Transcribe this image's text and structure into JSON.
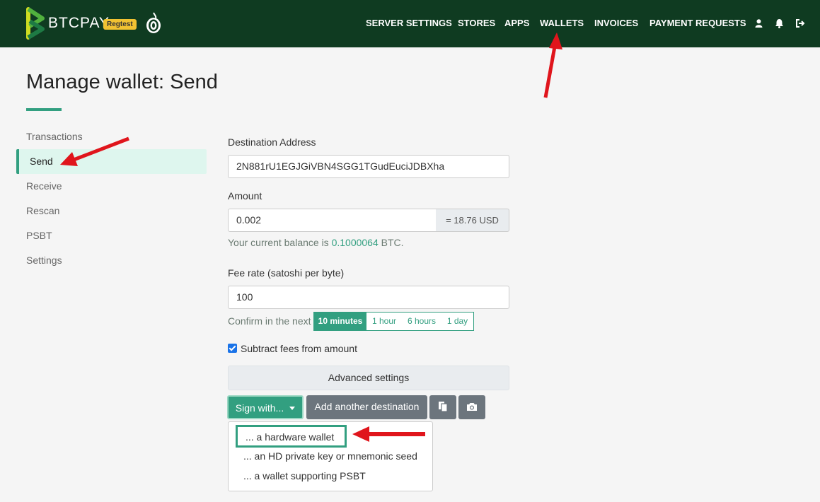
{
  "header": {
    "brand": "BTCPAY",
    "badge": "Regtest",
    "nav": [
      "SERVER SETTINGS",
      "STORES",
      "APPS",
      "WALLETS",
      "INVOICES",
      "PAYMENT REQUESTS"
    ]
  },
  "page": {
    "title": "Manage wallet: Send"
  },
  "sidebar": {
    "items": [
      {
        "label": "Transactions"
      },
      {
        "label": "Send",
        "active": true
      },
      {
        "label": "Receive"
      },
      {
        "label": "Rescan"
      },
      {
        "label": "PSBT"
      },
      {
        "label": "Settings"
      }
    ]
  },
  "form": {
    "destination_label": "Destination Address",
    "destination_value": "2N881rU1EGJGiVBN4SGG1TGudEuciJDBXha",
    "amount_label": "Amount",
    "amount_value": "0.002",
    "amount_fiat": "= 18.76 USD",
    "balance_prefix": "Your current balance is",
    "balance_value": "0.1000064",
    "balance_suffix": "BTC.",
    "fee_label": "Fee rate (satoshi per byte)",
    "fee_value": "100",
    "confirm_label": "Confirm in the next",
    "fee_options": [
      "10 minutes",
      "1 hour",
      "6 hours",
      "1 day"
    ],
    "fee_selected": "10 minutes",
    "subtract_fees_label": "Subtract fees from amount",
    "subtract_fees_checked": true,
    "advanced_label": "Advanced settings"
  },
  "actions": {
    "sign_label": "Sign with...",
    "add_destination_label": "Add another destination",
    "paste_icon": "paste-icon",
    "camera_icon": "camera-icon"
  },
  "sign_menu": {
    "items": [
      "... a hardware wallet",
      "... an HD private key or mnemonic seed",
      "... a wallet supporting PSBT"
    ]
  },
  "colors": {
    "header_bg": "#0f3b21",
    "accent": "#329f80",
    "annotation_arrow": "#e0151c"
  }
}
